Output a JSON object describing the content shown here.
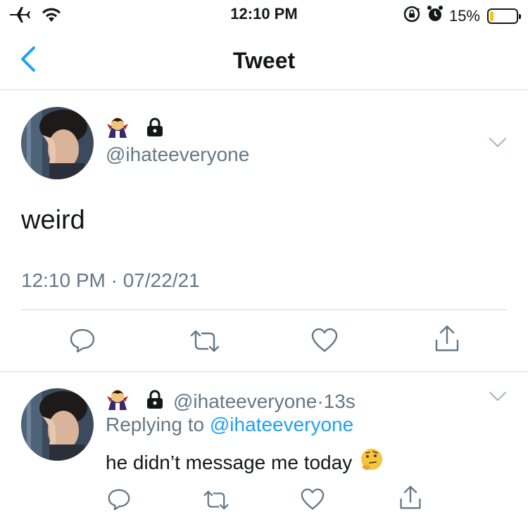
{
  "status_bar": {
    "time": "12:10 PM",
    "battery_percent_text": "15%",
    "battery_level": 0.15,
    "icons": [
      "airplane-icon",
      "wifi-icon",
      "orientation-lock-icon",
      "alarm-icon",
      "battery-icon"
    ]
  },
  "nav": {
    "title": "Tweet",
    "back_icon": "chevron-left-icon"
  },
  "tweet": {
    "name_emojis": [
      "vampire-emoji",
      "lock-icon"
    ],
    "handle": "@ihateeveryone",
    "text": "weird",
    "timestamp": "12:10 PM · 07/22/21",
    "actions": [
      "reply-icon",
      "retweet-icon",
      "like-icon",
      "share-icon"
    ]
  },
  "reply": {
    "handle": "@ihateeveryone",
    "separator": "·",
    "age": "13s",
    "replying_prefix": "Replying to",
    "replying_to": "@ihateeveryone",
    "text": "he didn’t message me today",
    "trailing_emoji": "thinking-face-emoji",
    "actions": [
      "reply-icon",
      "retweet-icon",
      "like-icon",
      "share-icon"
    ]
  },
  "colors": {
    "accent": "#1da1f2",
    "secondary_text": "#657786",
    "divider": "#d6d9db",
    "battery_low": "#f5c518"
  }
}
